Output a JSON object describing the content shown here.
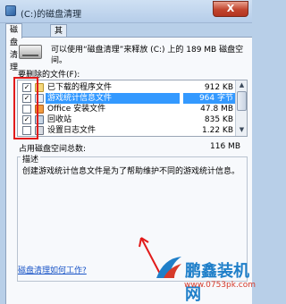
{
  "window": {
    "title": "(C:)的磁盘清理",
    "close_label": "X"
  },
  "tabs": [
    {
      "label": "磁盘清理",
      "active": true
    },
    {
      "label": "其他选项",
      "active": false
    }
  ],
  "info": {
    "text": "可以使用“磁盘清理”来释放 (C:) 上的 189 MB 磁盘空间。"
  },
  "files_label": "要删除的文件(F):",
  "files": [
    {
      "name": "已下载的程序文件",
      "size": "912 KB",
      "checked": true,
      "icon": "folder-icon",
      "selected": false
    },
    {
      "name": "游戏统计信息文件",
      "size": "964 字节",
      "checked": true,
      "icon": "document-icon",
      "selected": true
    },
    {
      "name": "Office 安装文件",
      "size": "47.8 MB",
      "checked": false,
      "icon": "office-icon",
      "selected": false
    },
    {
      "name": "回收站",
      "size": "835 KB",
      "checked": true,
      "icon": "recycle-bin-icon",
      "selected": false
    },
    {
      "name": "设置日志文件",
      "size": "1.22 KB",
      "checked": false,
      "icon": "setup-log-icon",
      "selected": false
    }
  ],
  "total": {
    "label": "占用磁盘空间总数:",
    "value": "116 MB"
  },
  "description": {
    "title": "描述",
    "text": "创建游戏统计信息文件是为了帮助维护不同的游戏统计信息。"
  },
  "help_link": "磁盘清理如何工作?",
  "watermark": {
    "brand": "鹏鑫装机网",
    "url": "www.0753pk.com"
  },
  "colors": {
    "highlight": "#3399ff",
    "annotation_red": "#e21b1b",
    "watermark_blue": "#1f7fc9",
    "watermark_red": "#d63a2a"
  }
}
